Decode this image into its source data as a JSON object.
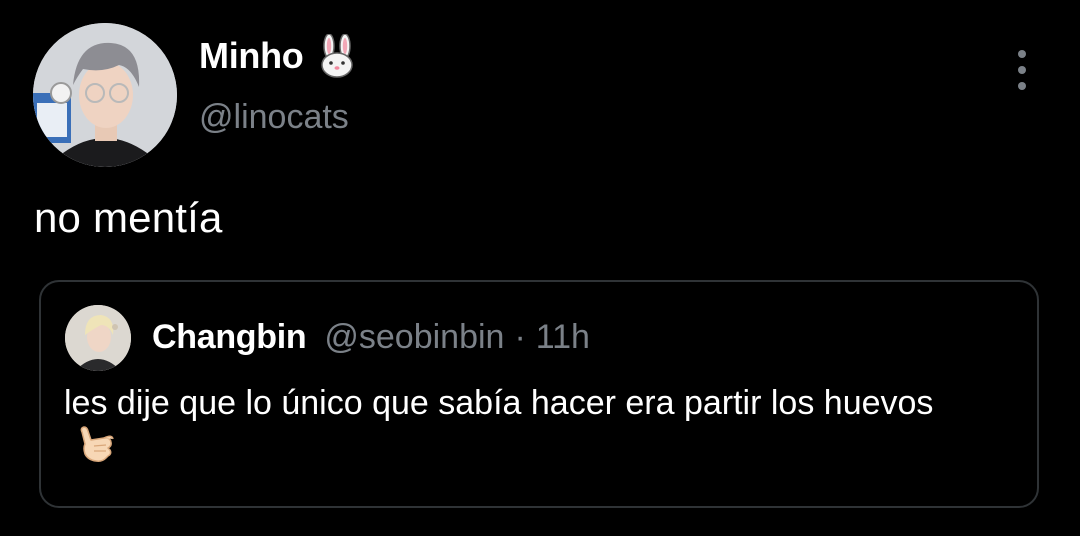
{
  "tweet": {
    "author": {
      "name": "Minho",
      "name_emoji_icon": "rabbit-face-icon",
      "handle": "@linocats"
    },
    "more_icon": "more-vertical-icon",
    "text": "no mentía",
    "quote": {
      "author": {
        "name": "Changbin",
        "handle": "@seobinbin"
      },
      "separator": "·",
      "time": "11h",
      "text": "les dije que lo único que sabía hacer era partir los huevos",
      "text_emoji_icon": "call-me-hand-icon"
    }
  },
  "colors": {
    "background": "#000000",
    "primary_text": "#ffffff",
    "secondary_text": "#7b8188",
    "border": "#2f3336"
  }
}
